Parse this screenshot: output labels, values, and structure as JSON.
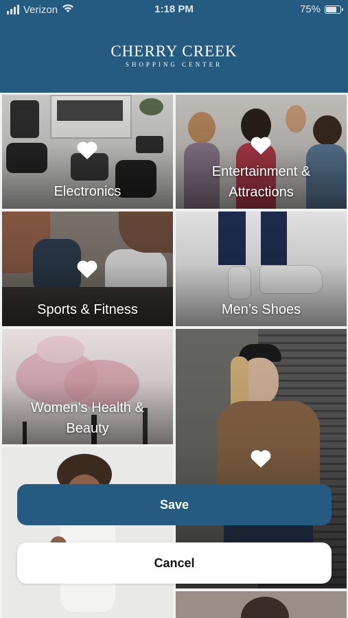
{
  "status_bar": {
    "carrier": "Verizon",
    "time": "1:18 PM",
    "battery_percent": "75%",
    "battery_level": 0.75
  },
  "header": {
    "logo_line1": "CHERRY CREEK",
    "logo_line2": "SHOPPING CENTER"
  },
  "categories": [
    {
      "label": "Electronics",
      "favorited": true
    },
    {
      "label_line1": "Entertainment &",
      "label_line2": "Attractions",
      "favorited": true
    },
    {
      "label": "Sports & Fitness",
      "favorited": true
    },
    {
      "label": "Men’s Shoes",
      "favorited": false
    },
    {
      "label_line1": "Women’s Health &",
      "label_line2": "Beauty",
      "favorited": false
    },
    {
      "label": "",
      "favorited": true
    }
  ],
  "actions": {
    "save_label": "Save",
    "cancel_label": "Cancel"
  },
  "icons": [
    "signal-icon",
    "wifi-icon",
    "battery-icon",
    "heart-icon"
  ],
  "colors": {
    "brand_blue": "#255b80",
    "button_text_dark": "#111111",
    "white": "#ffffff"
  }
}
